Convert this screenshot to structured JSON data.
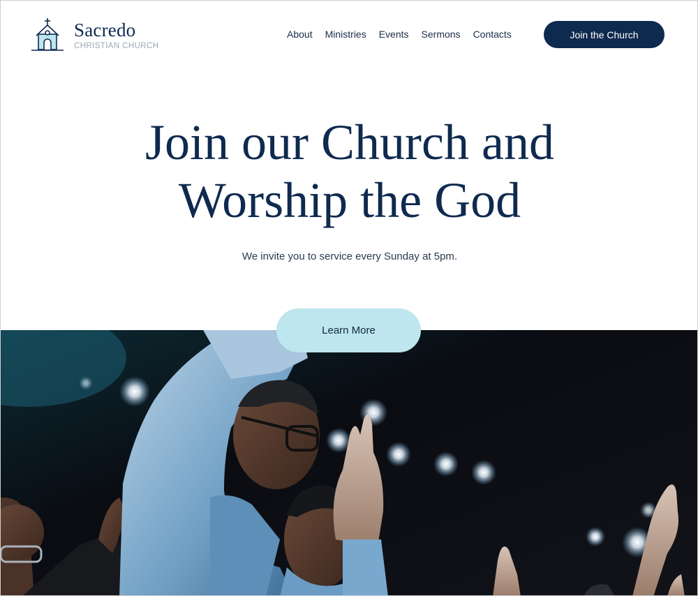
{
  "brand": {
    "name": "Sacredo",
    "subtitle": "CHRISTIAN CHURCH",
    "icon": "church-icon"
  },
  "nav": {
    "items": [
      "About",
      "Ministries",
      "Events",
      "Sermons",
      "Contacts"
    ],
    "cta_label": "Join the Church"
  },
  "hero": {
    "title_line1": "Join our Church and",
    "title_line2": "Worship the God",
    "subtitle": "We invite you to service every Sunday at 5pm.",
    "button_label": "Learn More"
  },
  "photo": {
    "subject": "worship-congregation-photo"
  },
  "colors": {
    "brand_navy": "#0f2a4f",
    "button_light_blue": "#bde6ef",
    "muted_text": "#9aa7b5"
  }
}
